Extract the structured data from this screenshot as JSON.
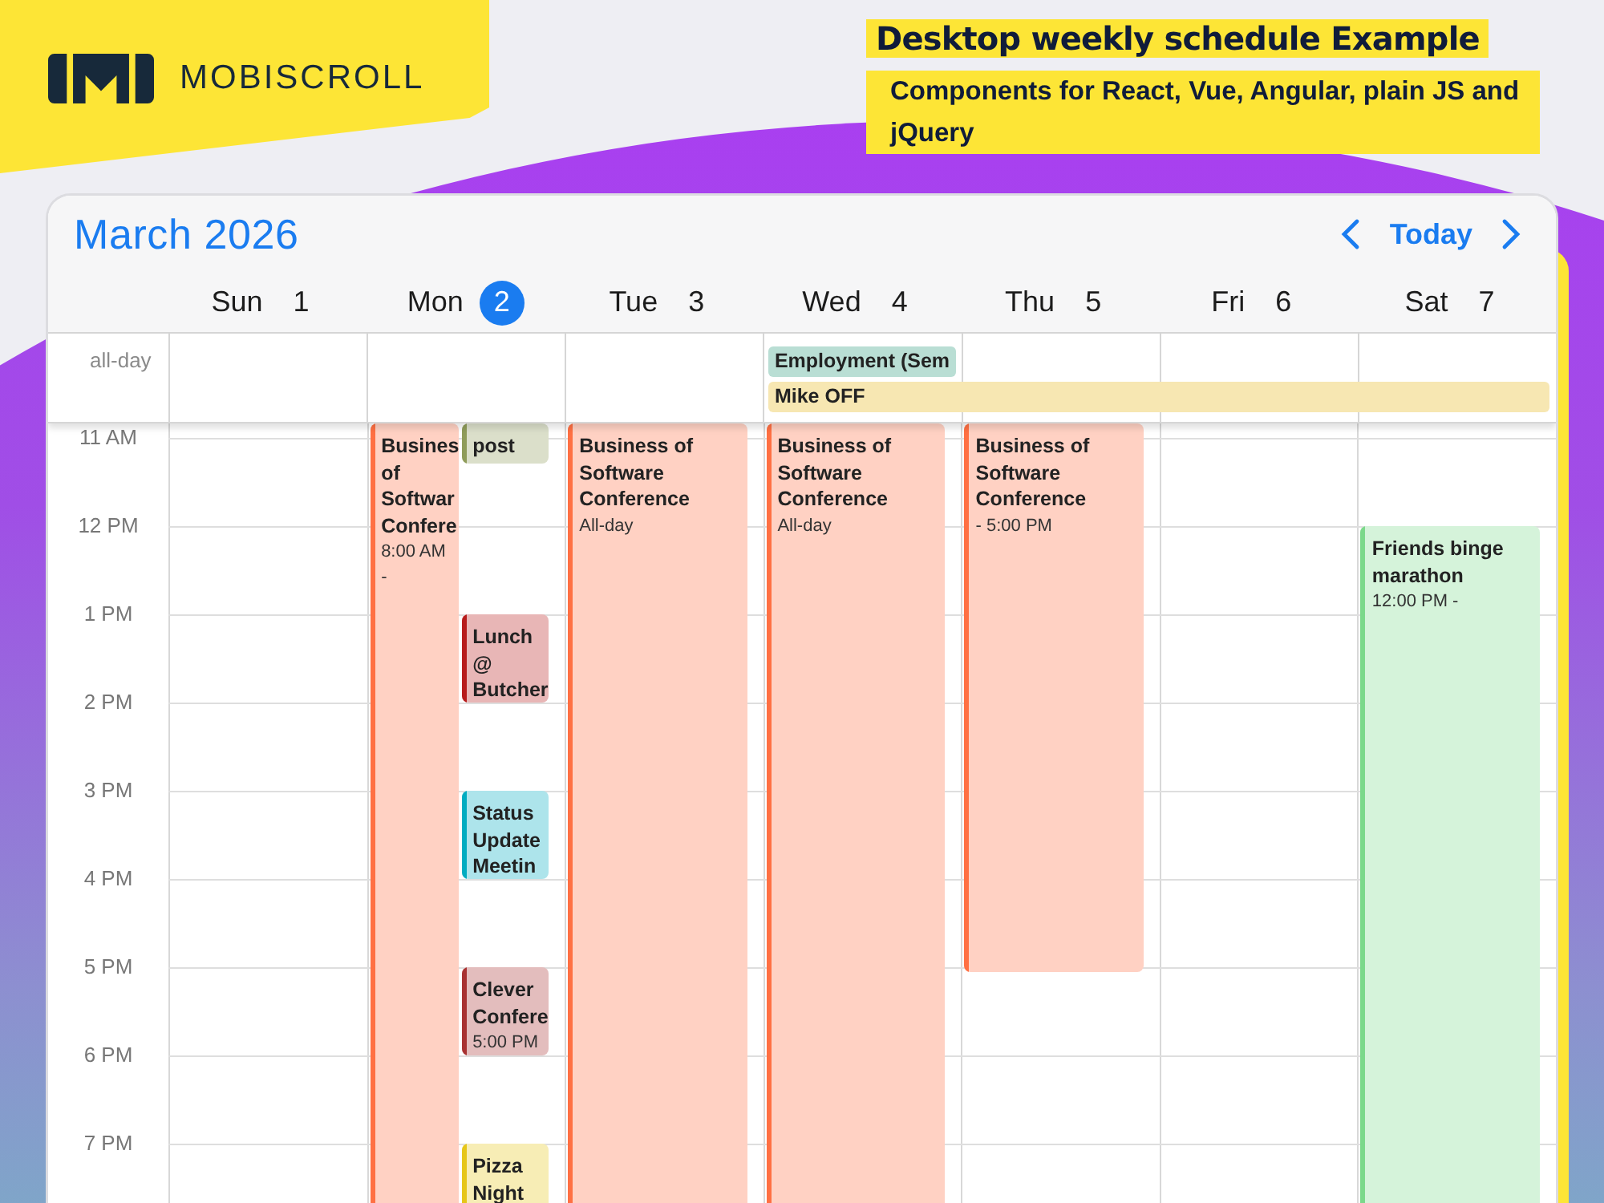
{
  "brand": {
    "name": "MOBISCROLL"
  },
  "headline": {
    "title": "Desktop weekly schedule Example",
    "subtitle": "Components for React, Vue, Angular, plain JS and jQuery"
  },
  "calendar": {
    "title": "March 2026",
    "today_button": "Today",
    "days": [
      {
        "name": "Sun",
        "date": "1",
        "today": false
      },
      {
        "name": "Mon",
        "date": "2",
        "today": true
      },
      {
        "name": "Tue",
        "date": "3",
        "today": false
      },
      {
        "name": "Wed",
        "date": "4",
        "today": false
      },
      {
        "name": "Thu",
        "date": "5",
        "today": false
      },
      {
        "name": "Fri",
        "date": "6",
        "today": false
      },
      {
        "name": "Sat",
        "date": "7",
        "today": false
      }
    ],
    "all_day_label": "all-day",
    "all_day_events": [
      {
        "title": "Employment (Sem",
        "color": "#b9ded4"
      },
      {
        "title": "Mike OFF",
        "color": "#f7e7b2"
      }
    ],
    "hours": [
      "11 AM",
      "12 PM",
      "1 PM",
      "2 PM",
      "3 PM",
      "4 PM",
      "5 PM",
      "6 PM",
      "7 PM"
    ],
    "events": [
      {
        "title": "Busines of Softwar Confere",
        "time": "8:00 AM -",
        "color": "#ff7043"
      },
      {
        "title": "post",
        "color": "#8f9c5a"
      },
      {
        "title": "Lunch @ Butcher",
        "color": "#b71c1c"
      },
      {
        "title": "Status Update Meetin",
        "color": "#00acc1"
      },
      {
        "title": "Clever Confere",
        "time": "5:00 PM",
        "color": "#a83232"
      },
      {
        "title": "Pizza Night",
        "color": "#e6c619"
      },
      {
        "title": "Business of Software Conference",
        "time": "All-day",
        "color": "#ff7043"
      },
      {
        "title": "Business of Software Conference",
        "time": "All-day",
        "color": "#ff7043"
      },
      {
        "title": "Business of Software Conference",
        "time": "- 5:00 PM",
        "color": "#ff7043"
      },
      {
        "title": "Friends binge marathon",
        "time": "12:00 PM -",
        "color": "#7bd88a"
      }
    ]
  }
}
